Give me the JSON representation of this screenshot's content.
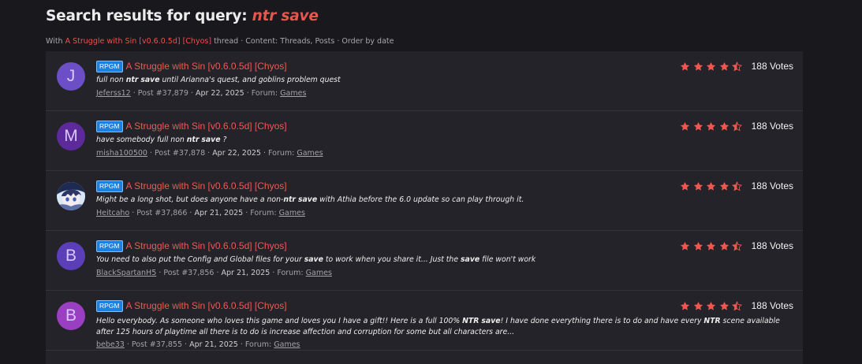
{
  "header": {
    "title_prefix": "Search results for query: ",
    "query": "ntr save"
  },
  "filter_line": {
    "with": "With",
    "thread_name": "A Struggle with Sin [v0.6.0.5d] [Chyos]",
    "rest": "thread · Content: Threads, Posts · Order by date"
  },
  "colors": {
    "accent": "#e7554f",
    "badge": "#1d7fe0",
    "star": "#f2564f",
    "background": "#19181d",
    "panel": "#242329"
  },
  "results": [
    {
      "avatar_letter": "J",
      "avatar_color": "#6c4fc6",
      "prefix": "RPGM",
      "thread_title": "A Struggle with Sin [v0.6.0.5d] [Chyos]",
      "snippet": [
        {
          "t": "full non "
        },
        {
          "t": "ntr",
          "b": true
        },
        {
          "t": " "
        },
        {
          "t": "save",
          "b": true
        },
        {
          "t": " until Arianna's quest, and goblins problem quest"
        }
      ],
      "user": "Jeferss12",
      "post": "Post #37,879",
      "date": "Apr 22, 2025",
      "forum_label": "Forum:",
      "forum": "Games",
      "rating": 4.5,
      "votes": "188 Votes"
    },
    {
      "avatar_letter": "M",
      "avatar_color": "#5c2a9a",
      "prefix": "RPGM",
      "thread_title": "A Struggle with Sin [v0.6.0.5d] [Chyos]",
      "snippet": [
        {
          "t": "have somebody full non "
        },
        {
          "t": "ntr",
          "b": true
        },
        {
          "t": " "
        },
        {
          "t": "save",
          "b": true
        },
        {
          "t": " ?"
        }
      ],
      "user": "misha100500",
      "post": "Post #37,878",
      "date": "Apr 22, 2025",
      "forum_label": "Forum:",
      "forum": "Games",
      "rating": 4.5,
      "votes": "188 Votes"
    },
    {
      "avatar_letter": "",
      "avatar_color": "#2a3b6e",
      "avatar_image": "anime-avatar-icon",
      "prefix": "RPGM",
      "thread_title": "A Struggle with Sin [v0.6.0.5d] [Chyos]",
      "snippet": [
        {
          "t": "Might be a long shot, but does anyone have a non-"
        },
        {
          "t": "ntr",
          "b": true
        },
        {
          "t": " "
        },
        {
          "t": "save",
          "b": true
        },
        {
          "t": " with Athia before the 6.0 update so can play through it."
        }
      ],
      "user": "Heitcaho",
      "post": "Post #37,866",
      "date": "Apr 21, 2025",
      "forum_label": "Forum:",
      "forum": "Games",
      "rating": 4.5,
      "votes": "188 Votes"
    },
    {
      "avatar_letter": "B",
      "avatar_color": "#5a3fb8",
      "prefix": "RPGM",
      "thread_title": "A Struggle with Sin [v0.6.0.5d] [Chyos]",
      "snippet": [
        {
          "t": "You need to also put the Config and Global files for your "
        },
        {
          "t": "save",
          "b": true
        },
        {
          "t": " to work when you share it... Just the "
        },
        {
          "t": "save",
          "b": true
        },
        {
          "t": " file won't work"
        }
      ],
      "user": "BlackSpartanH5",
      "post": "Post #37,856",
      "date": "Apr 21, 2025",
      "forum_label": "Forum:",
      "forum": "Games",
      "rating": 4.5,
      "votes": "188 Votes"
    },
    {
      "avatar_letter": "B",
      "avatar_color": "#9b3fc2",
      "prefix": "RPGM",
      "thread_title": "A Struggle with Sin [v0.6.0.5d] [Chyos]",
      "snippet": [
        {
          "t": "Hello everybody. As someone who loves this game and loves you I have a gift!! Here is a full 100% "
        },
        {
          "t": "NTR",
          "b": true
        },
        {
          "t": " "
        },
        {
          "t": "save",
          "b": true
        },
        {
          "t": "! I have done everything there is to do and have every "
        },
        {
          "t": "NTR",
          "b": true
        },
        {
          "t": " scene available after 125 hours of playtime all there is to do is increase affection and corruption for some but all characters are..."
        }
      ],
      "user": "bebe33",
      "post": "Post #37,855",
      "date": "Apr 21, 2025",
      "forum_label": "Forum:",
      "forum": "Games",
      "rating": 4.5,
      "votes": "188 Votes"
    }
  ]
}
